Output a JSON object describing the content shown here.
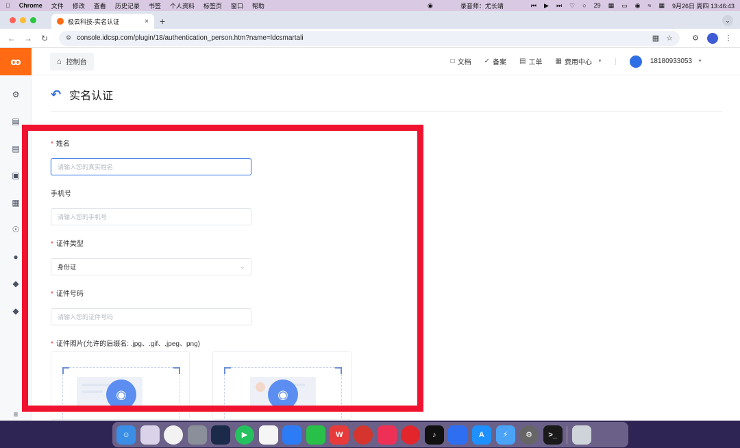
{
  "mac_menubar": {
    "apple": "",
    "items": [
      "Chrome",
      "文件",
      "修改",
      "查看",
      "历史记录",
      "书签",
      "个人资料",
      "标签页",
      "窗口",
      "帮助"
    ],
    "recorder": "录音师：尤长靖",
    "battery_count": "29",
    "datetime": "9月26日 周四  13:46:43"
  },
  "browser": {
    "tab_title": "极云科技-实名认证",
    "tab_close": "×",
    "new_tab": "+",
    "url": "console.idcsp.com/plugin/18/authentication_person.htm?name=ldcsmartali"
  },
  "header": {
    "logo_text": "ꝏ",
    "console_label": "控制台",
    "links": [
      {
        "label": "文档",
        "icon": "document-icon"
      },
      {
        "label": "备案",
        "icon": "shield-check-icon"
      },
      {
        "label": "工单",
        "icon": "ticket-icon"
      },
      {
        "label": "费用中心",
        "icon": "billing-icon"
      }
    ],
    "user_phone": "18180933053"
  },
  "page": {
    "title": "实名认证"
  },
  "form": {
    "name_label": "姓名",
    "name_placeholder": "请输入您的真实姓名",
    "phone_label": "手机号",
    "phone_placeholder": "请输入您的手机号",
    "idtype_label": "证件类型",
    "idtype_value": "身份证",
    "idnumber_label": "证件号码",
    "idnumber_placeholder": "请输入您的证件号码",
    "photo_label": "证件照片(允许的后缀名: .jpg、.gif、.jpeg、png)",
    "required_mark": "*"
  },
  "colors": {
    "brand_orange": "#ff6a13",
    "accent_blue": "#2f6ee5",
    "highlight_red": "#f0132f"
  }
}
